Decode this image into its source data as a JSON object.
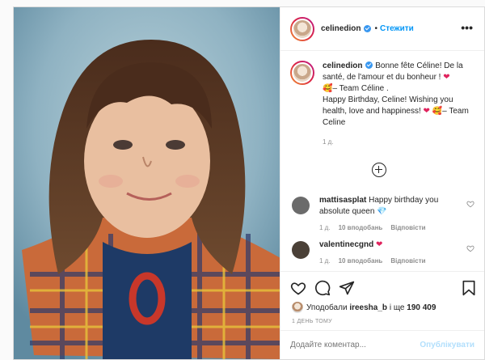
{
  "post": {
    "photo_alt_icon": "photo",
    "header": {
      "username": "celinedion",
      "separator": "•",
      "follow_label": "Стежити",
      "more_label": "•••"
    },
    "caption": {
      "username": "celinedion",
      "text_fr": "Bonne fête Céline! De la santé, de l'amour et du bonheur !",
      "team_fr": "– Team Céline .",
      "text_en": "Happy Birthday, Celine!  Wishing you health, love and happiness!",
      "team_en": "– Team Celine",
      "time": "1 д."
    },
    "load_more_icon": "plus-circle-icon",
    "comments": [
      {
        "username": "mattisasplat",
        "text": "Happy birthday you absolute queen",
        "time": "1 д.",
        "likes": "10 вподобань",
        "reply": "Відповісти",
        "avatar_color": "#6b6b6b"
      },
      {
        "username": "valentinecgnd",
        "text": "",
        "time": "1 д.",
        "likes": "10 вподобань",
        "reply": "Відповісти",
        "avatar_color": "#4a4037"
      }
    ],
    "likes_prefix": "Уподобали",
    "likes_user": "ireesha_b",
    "likes_middle": "і ще",
    "likes_count": "190 409",
    "posted_ago": "1 ДЕНЬ ТОМУ",
    "comment_input_placeholder": "Додайте коментар...",
    "publish_label": "Опублікувати",
    "colors": {
      "accent": "#0095f6",
      "heart": "#e0245e",
      "publish_disabled": "#b2dffc"
    }
  }
}
